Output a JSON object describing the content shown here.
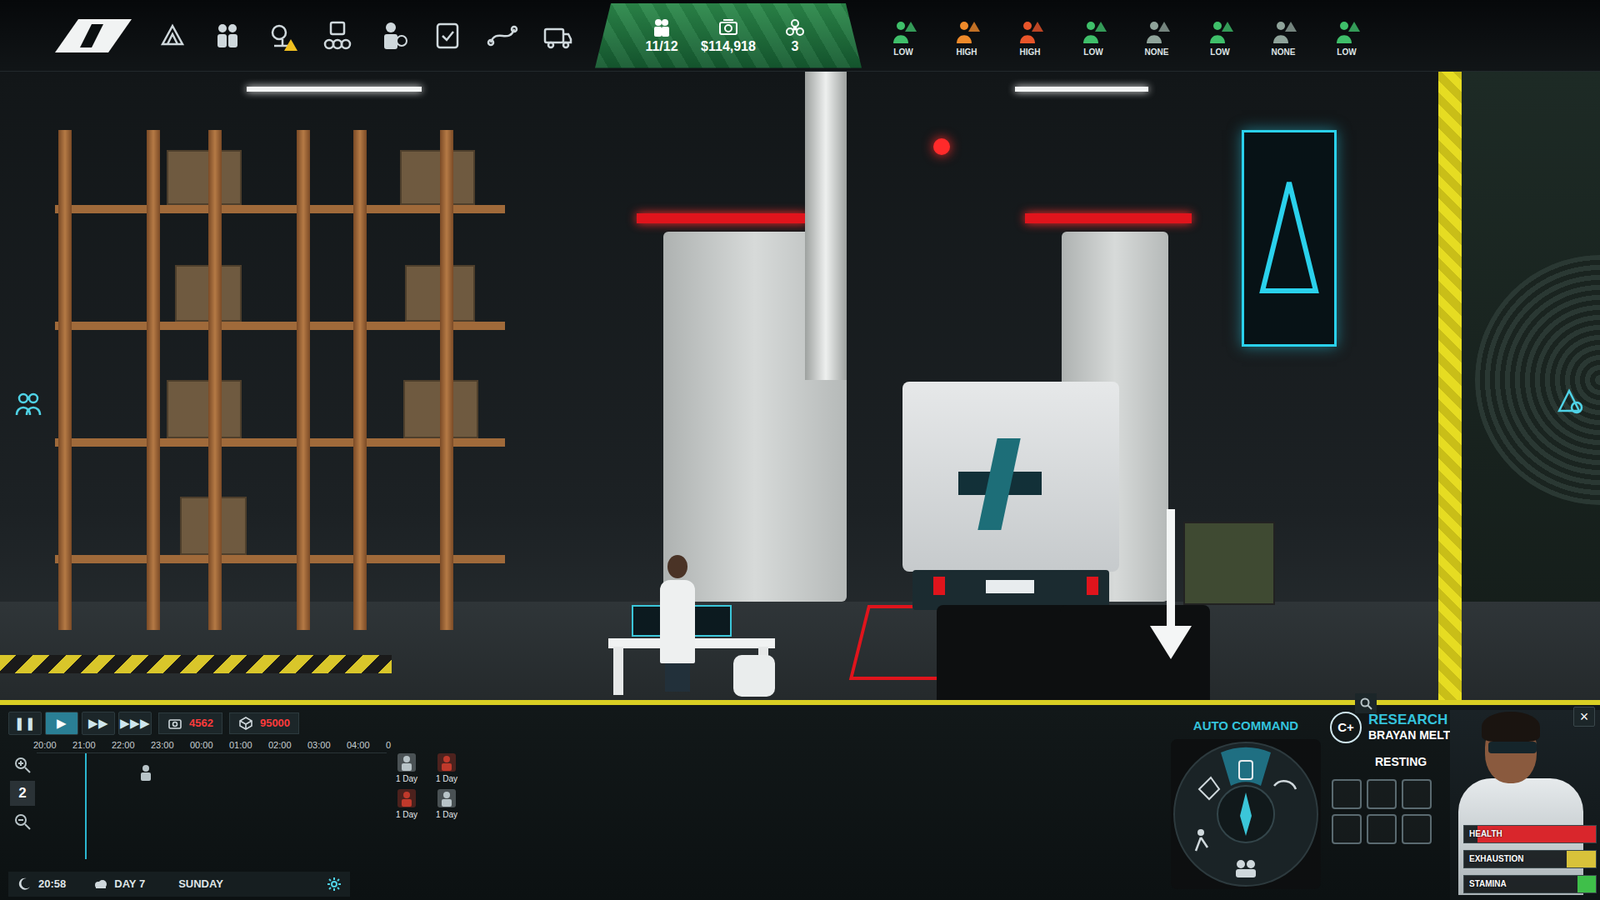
{
  "topbar": {
    "stats": [
      {
        "kind": "population",
        "value": "11/12"
      },
      {
        "kind": "money",
        "value": "$114,918"
      },
      {
        "kind": "hazard",
        "value": "3"
      }
    ],
    "alerts": [
      {
        "label": "LOW",
        "color": "#3fbf6a"
      },
      {
        "label": "HIGH",
        "color": "#ef8a2a"
      },
      {
        "label": "HIGH",
        "color": "#e8552a"
      },
      {
        "label": "LOW",
        "color": "#3fbf6a"
      },
      {
        "label": "NONE",
        "color": "#8fa39a"
      },
      {
        "label": "LOW",
        "color": "#3fbf6a"
      },
      {
        "label": "NONE",
        "color": "#8fa39a"
      },
      {
        "label": "LOW",
        "color": "#3fbf6a"
      }
    ]
  },
  "timeline": {
    "playback": [
      {
        "symbol": "❚❚",
        "selected": false
      },
      {
        "symbol": "▶",
        "selected": true
      },
      {
        "symbol": "▶▶",
        "selected": false
      },
      {
        "symbol": "▶▶▶",
        "selected": false
      }
    ],
    "costs": [
      {
        "kind": "money",
        "value": "4562"
      },
      {
        "kind": "supplies",
        "value": "95000"
      }
    ],
    "hours": [
      "20:00",
      "21:00",
      "22:00",
      "23:00",
      "00:00",
      "01:00",
      "02:00",
      "03:00",
      "04:00",
      "0"
    ],
    "zoom": "2",
    "schedule": [
      {
        "label": "1 Day",
        "color": "#b8c4c8"
      },
      {
        "label": "1 Day",
        "color": "#c0392b"
      },
      {
        "label": "1 Day",
        "color": "#c0392b"
      },
      {
        "label": "1 Day",
        "color": "#b8c4c8"
      }
    ],
    "clock": {
      "time": "20:58",
      "day": "DAY 7",
      "weekday": "SUNDAY"
    }
  },
  "command": {
    "title": "AUTO COMMAND"
  },
  "character": {
    "badge": "C+",
    "role": "RESEARCH",
    "name": "BRAYAN MELTON",
    "status": "RESTING",
    "close": "×",
    "slots": [
      {
        "filled": false
      },
      {
        "filled": false
      },
      {
        "filled": false
      },
      {
        "filled": false
      },
      {
        "filled": false
      },
      {
        "filled": false
      }
    ],
    "meters": [
      {
        "label": "HEALTH",
        "level": 0.9,
        "color": "#d9262c"
      },
      {
        "label": "EXHAUSTION",
        "level": 0.22,
        "color": "#d8c23a"
      },
      {
        "label": "STAMINA",
        "level": 0.14,
        "color": "#3fbf4a"
      }
    ]
  }
}
